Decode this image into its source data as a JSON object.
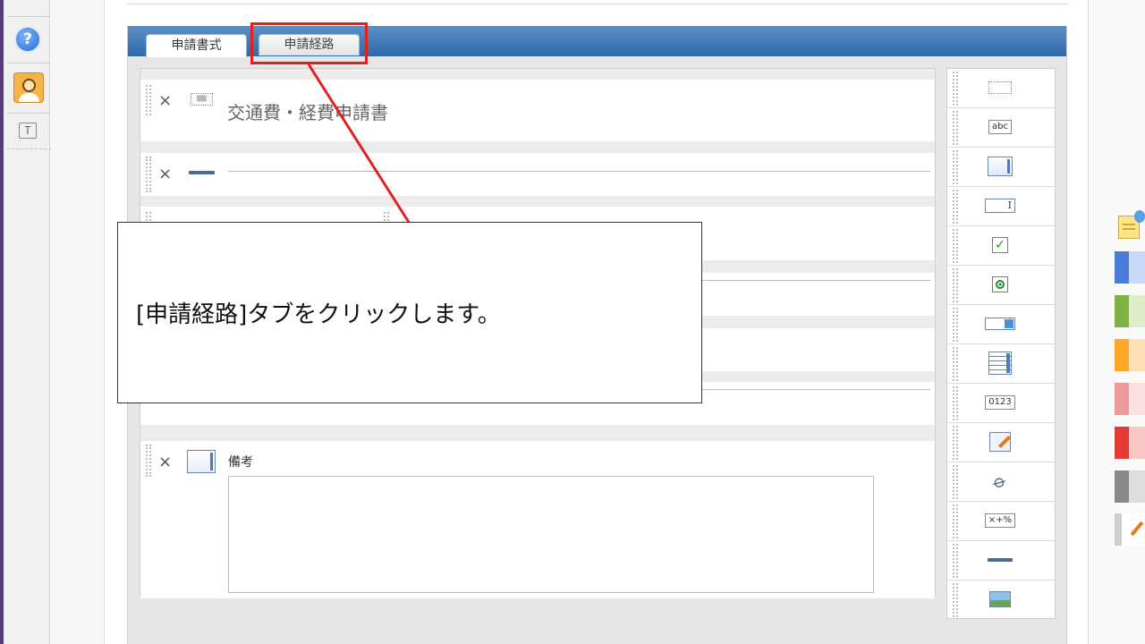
{
  "toolbar": {
    "icons": [
      "question-icon",
      "support-agent-icon",
      "text-tool-icon"
    ],
    "help_glyph": "?",
    "text_glyph": "T"
  },
  "tabs": {
    "active_label": "申請書式",
    "route_label": "申請経路"
  },
  "form": {
    "title": "交通費・経費申請書",
    "remarks_label": "備考",
    "remarks_value": "",
    "delete_glyph": "×"
  },
  "palette": {
    "items": [
      {
        "icon": "text-label-icon",
        "text": ""
      },
      {
        "icon": "text-input-icon",
        "text": "abc"
      },
      {
        "icon": "textarea-icon",
        "text": ""
      },
      {
        "icon": "input-field-icon",
        "text": "I"
      },
      {
        "icon": "checkbox-icon",
        "text": "✓"
      },
      {
        "icon": "radio-button-icon",
        "text": ""
      },
      {
        "icon": "select-dropdown-icon",
        "text": ""
      },
      {
        "icon": "list-box-icon",
        "text": ""
      },
      {
        "icon": "number-input-icon",
        "text": "0123"
      },
      {
        "icon": "rich-text-icon",
        "text": ""
      },
      {
        "icon": "attachment-icon",
        "text": "📎"
      },
      {
        "icon": "calculation-icon",
        "text": "×+%"
      },
      {
        "icon": "horizontal-rule-icon",
        "text": ""
      },
      {
        "icon": "image-icon",
        "text": ""
      }
    ]
  },
  "right_tabs": {
    "colors": [
      "#4a7bd8",
      "#7cb342",
      "#ffa726",
      "#ef9a9a",
      "#e53935",
      "#888888"
    ]
  },
  "callout": {
    "text": "[申請経路]タブをクリックします。",
    "highlight_color": "#e32020"
  }
}
